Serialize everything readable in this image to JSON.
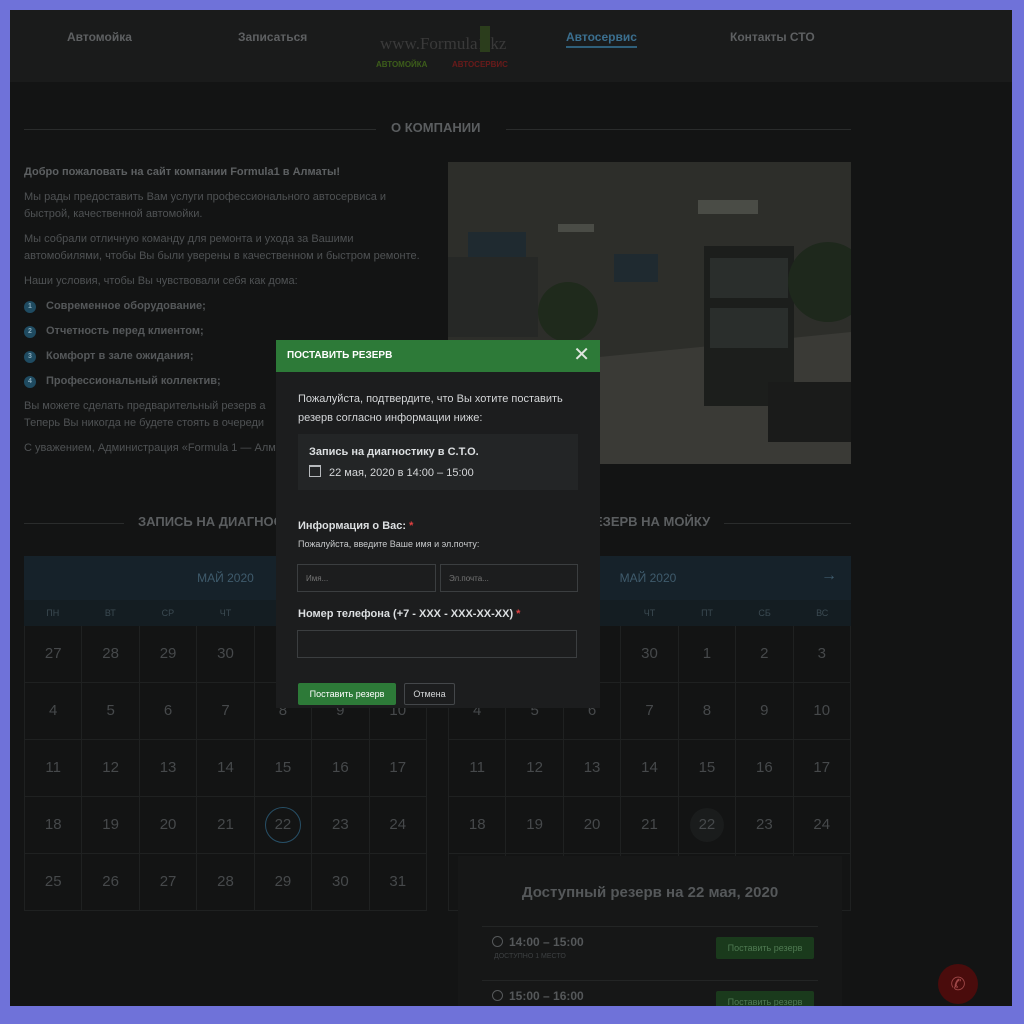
{
  "nav": {
    "items": [
      "Автомойка",
      "Записаться",
      "Автосервис",
      "Контакты СТО"
    ],
    "active": "Автосервис",
    "logo_url": "www.Formula1.kz",
    "logo_left": "АВТОМОЙКА",
    "logo_right": "АВТОСЕРВИС"
  },
  "about": {
    "heading": "О КОМПАНИИ",
    "lead": "Добро пожаловать на сайт компании Formula1 в Алматы!",
    "p1": "Мы рады предоставить Вам услуги профессионального автосервиса и быстрой, качественной автомойки.",
    "p2": "Мы собрали отличную команду для ремонта и ухода за Вашими автомобилями, чтобы Вы были уверены в качественном и быстром ремонте.",
    "p3": "Наши условия, чтобы Вы чувствовали себя как дома:",
    "features": [
      "Современное оборудование;",
      "Отчетность перед клиентом;",
      "Комфорт в зале ожидания;",
      "Профессиональный коллектив;"
    ],
    "p4a": "Вы можете сделать предварительный резерв а",
    "p4b": "Теперь Вы никогда не будете стоять в очереди",
    "sign": "С уважением, Администрация «Formula 1 — Алм"
  },
  "sections": {
    "left": "ЗАПИСЬ НА ДИАГНОС",
    "right": "ЕЗЕРВ НА МОЙКУ"
  },
  "calendar": {
    "month": "МАЙ 2020",
    "dow": [
      "ПН",
      "ВТ",
      "СР",
      "ЧТ",
      "ПТ",
      "СБ",
      "ВС"
    ],
    "days": [
      "27",
      "28",
      "29",
      "30",
      "1",
      "2",
      "3",
      "4",
      "5",
      "6",
      "7",
      "8",
      "9",
      "10",
      "11",
      "12",
      "13",
      "14",
      "15",
      "16",
      "17",
      "18",
      "19",
      "20",
      "21",
      "22",
      "23",
      "24",
      "25",
      "26",
      "27",
      "28",
      "29",
      "30",
      "31"
    ],
    "next_icon": "arrow-right-icon"
  },
  "availability": {
    "title": "Доступный резерв на 22 мая, 2020",
    "slots": [
      {
        "time": "14:00 – 15:00",
        "sub": "ДОСТУПНО 1 МЕСТО",
        "button": "Поставить резерв"
      },
      {
        "time": "15:00 – 16:00",
        "button": "Поставить резерв"
      }
    ]
  },
  "modal": {
    "title": "ПОСТАВИТЬ РЕЗЕРВ",
    "intro": "Пожалуйста, подтвердите, что Вы хотите поставить резерв согласно информации ниже:",
    "summary_title": "Запись на диагностику в С.Т.О.",
    "summary_date": "22 мая, 2020 в 14:00 – 15:00",
    "info_label": "Информация о Вас:",
    "required_mark": "*",
    "info_hint": "Пожалуйста, введите Ваше имя и эл.почту:",
    "name_placeholder": "Имя...",
    "email_placeholder": "Эл.почта...",
    "phone_label": "Номер телефона (+7 - XXX - XXX-XX-XX)",
    "submit": "Поставить резерв",
    "cancel": "Отмена"
  },
  "colors": {
    "accent_green": "#2d7a38",
    "dimmed_background": "#131414",
    "required": "#e04040",
    "frame": "#6f72d9"
  }
}
